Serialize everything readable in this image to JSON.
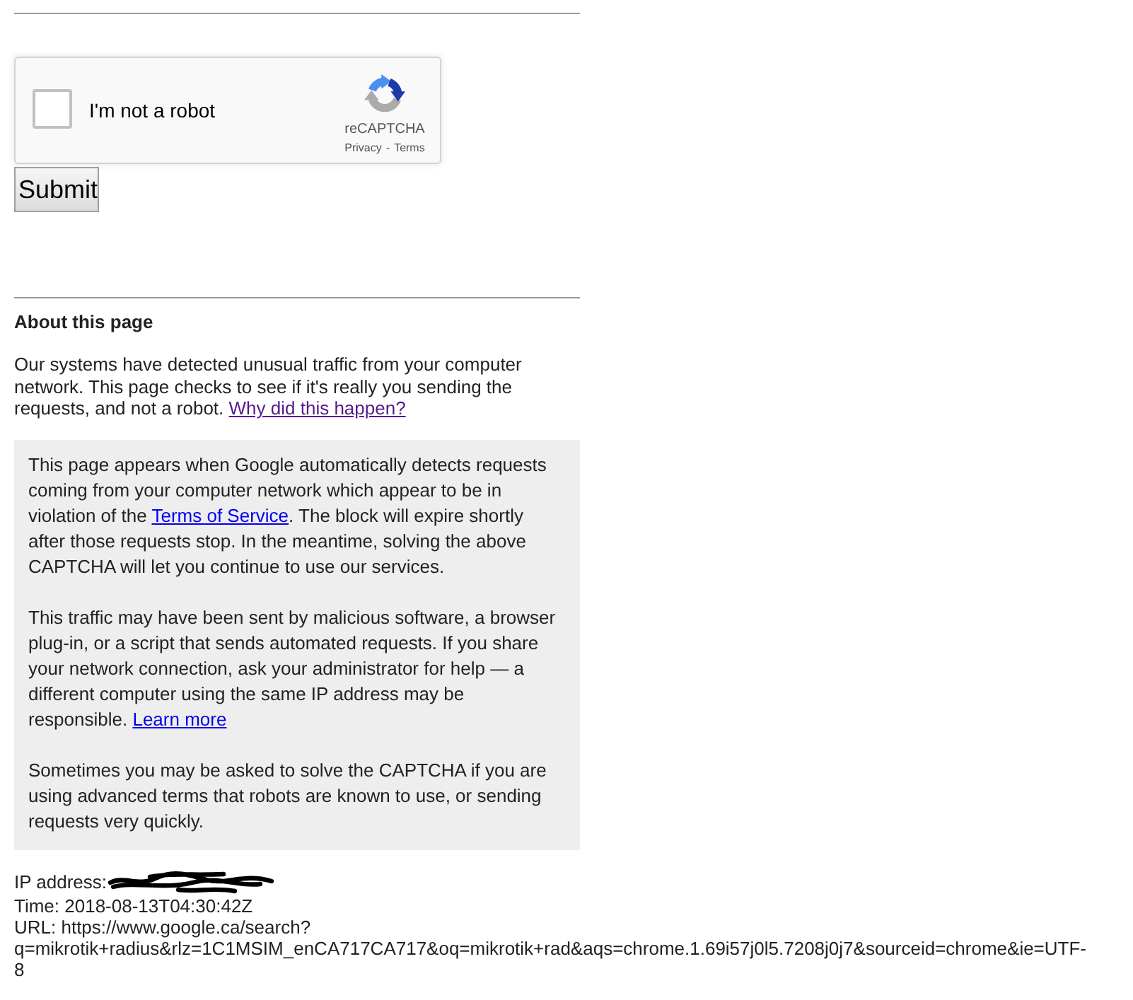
{
  "recaptcha": {
    "checked": false,
    "label": "I'm not a robot",
    "brand": "reCAPTCHA",
    "legal_links": [
      {
        "text": "Privacy"
      },
      {
        "text": "Terms"
      }
    ],
    "legal_separator": "-"
  },
  "submit_button": {
    "label": "Submit"
  },
  "about": {
    "heading": "About this page",
    "intro": [
      {
        "kind": "text",
        "text": "Our systems have detected unusual traffic from your computer network. This page checks to see if it's really you sending the requests, and not a robot. "
      },
      {
        "kind": "link",
        "text": "Why did this happen?",
        "visited": true
      }
    ]
  },
  "info_box": {
    "paragraphs": [
      [
        {
          "kind": "text",
          "text": "This page appears when Google automatically detects requests coming from your computer network which appear to be in violation of the "
        },
        {
          "kind": "link",
          "text": "Terms of Service",
          "visited": false
        },
        {
          "kind": "text",
          "text": ". The block will expire shortly after those requests stop. In the meantime, solving the above CAPTCHA will let you continue to use our services."
        }
      ],
      [
        {
          "kind": "text",
          "text": "This traffic may have been sent by malicious software, a browser plug-in, or a script that sends automated requests. If you share your network connection, ask your administrator for help — a different computer using the same IP address may be responsible. "
        },
        {
          "kind": "link",
          "text": "Learn more",
          "visited": false
        }
      ],
      [
        {
          "kind": "text",
          "text": "Sometimes you may be asked to solve the CAPTCHA if you are using advanced terms that robots are known to use, or sending requests very quickly."
        }
      ]
    ]
  },
  "details": {
    "ip_label": "IP address:",
    "ip_redacted": true,
    "time": "Time: 2018-08-13T04:30:42Z",
    "url": "URL: https://www.google.ca/search?q=mikrotik+radius&rlz=1C1MSIM_enCA717CA717&oq=mikrotik+rad&aqs=chrome.1.69i57j0l5.7208j0j7&sourceid=chrome&ie=UTF-8"
  }
}
